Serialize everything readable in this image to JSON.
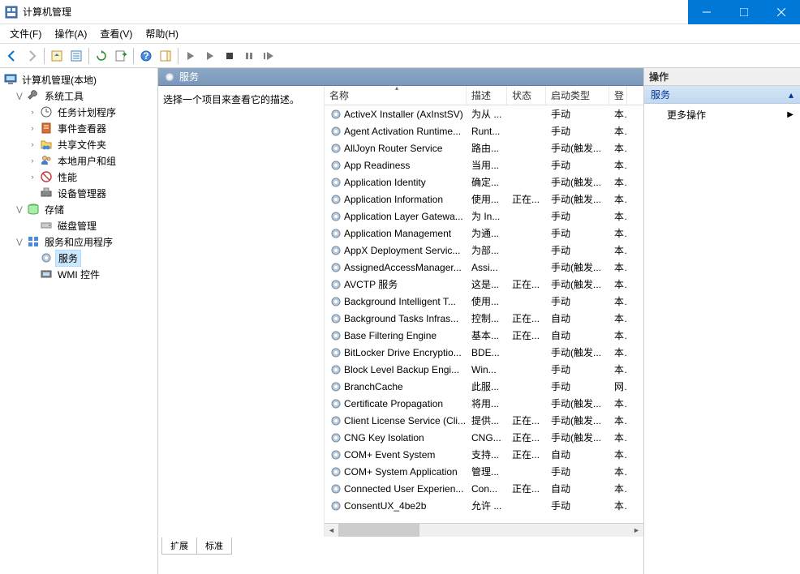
{
  "window": {
    "title": "计算机管理"
  },
  "menu": {
    "file": "文件(F)",
    "action": "操作(A)",
    "view": "查看(V)",
    "help": "帮助(H)"
  },
  "tree": {
    "root": "计算机管理(本地)",
    "system_tools": "系统工具",
    "task_scheduler": "任务计划程序",
    "event_viewer": "事件查看器",
    "shared_folders": "共享文件夹",
    "local_users": "本地用户和组",
    "performance": "性能",
    "device_manager": "设备管理器",
    "storage": "存储",
    "disk_management": "磁盘管理",
    "services_apps": "服务和应用程序",
    "services": "服务",
    "wmi_control": "WMI 控件"
  },
  "mid": {
    "header": "服务",
    "detail_prompt": "选择一个项目来查看它的描述。",
    "cols": {
      "name": "名称",
      "desc": "描述",
      "status": "状态",
      "startup": "启动类型",
      "logon": "登"
    },
    "tabs": {
      "extended": "扩展",
      "standard": "标准"
    }
  },
  "action": {
    "header": "操作",
    "section": "服务",
    "more": "更多操作"
  },
  "services": [
    {
      "name": "ActiveX Installer (AxInstSV)",
      "desc": "为从 ...",
      "status": "",
      "startup": "手动",
      "logon": "本"
    },
    {
      "name": "Agent Activation Runtime...",
      "desc": "Runt...",
      "status": "",
      "startup": "手动",
      "logon": "本"
    },
    {
      "name": "AllJoyn Router Service",
      "desc": "路由...",
      "status": "",
      "startup": "手动(触发...",
      "logon": "本"
    },
    {
      "name": "App Readiness",
      "desc": "当用...",
      "status": "",
      "startup": "手动",
      "logon": "本"
    },
    {
      "name": "Application Identity",
      "desc": "确定...",
      "status": "",
      "startup": "手动(触发...",
      "logon": "本"
    },
    {
      "name": "Application Information",
      "desc": "使用...",
      "status": "正在...",
      "startup": "手动(触发...",
      "logon": "本"
    },
    {
      "name": "Application Layer Gatewa...",
      "desc": "为 In...",
      "status": "",
      "startup": "手动",
      "logon": "本"
    },
    {
      "name": "Application Management",
      "desc": "为通...",
      "status": "",
      "startup": "手动",
      "logon": "本"
    },
    {
      "name": "AppX Deployment Servic...",
      "desc": "为部...",
      "status": "",
      "startup": "手动",
      "logon": "本"
    },
    {
      "name": "AssignedAccessManager...",
      "desc": "Assi...",
      "status": "",
      "startup": "手动(触发...",
      "logon": "本"
    },
    {
      "name": "AVCTP 服务",
      "desc": "这是...",
      "status": "正在...",
      "startup": "手动(触发...",
      "logon": "本"
    },
    {
      "name": "Background Intelligent T...",
      "desc": "使用...",
      "status": "",
      "startup": "手动",
      "logon": "本"
    },
    {
      "name": "Background Tasks Infras...",
      "desc": "控制...",
      "status": "正在...",
      "startup": "自动",
      "logon": "本"
    },
    {
      "name": "Base Filtering Engine",
      "desc": "基本...",
      "status": "正在...",
      "startup": "自动",
      "logon": "本"
    },
    {
      "name": "BitLocker Drive Encryptio...",
      "desc": "BDE...",
      "status": "",
      "startup": "手动(触发...",
      "logon": "本"
    },
    {
      "name": "Block Level Backup Engi...",
      "desc": "Win...",
      "status": "",
      "startup": "手动",
      "logon": "本"
    },
    {
      "name": "BranchCache",
      "desc": "此服...",
      "status": "",
      "startup": "手动",
      "logon": "网"
    },
    {
      "name": "Certificate Propagation",
      "desc": "将用...",
      "status": "",
      "startup": "手动(触发...",
      "logon": "本"
    },
    {
      "name": "Client License Service (Cli...",
      "desc": "提供...",
      "status": "正在...",
      "startup": "手动(触发...",
      "logon": "本"
    },
    {
      "name": "CNG Key Isolation",
      "desc": "CNG...",
      "status": "正在...",
      "startup": "手动(触发...",
      "logon": "本"
    },
    {
      "name": "COM+ Event System",
      "desc": "支持...",
      "status": "正在...",
      "startup": "自动",
      "logon": "本"
    },
    {
      "name": "COM+ System Application",
      "desc": "管理...",
      "status": "",
      "startup": "手动",
      "logon": "本"
    },
    {
      "name": "Connected User Experien...",
      "desc": "Con...",
      "status": "正在...",
      "startup": "自动",
      "logon": "本"
    },
    {
      "name": "ConsentUX_4be2b",
      "desc": "允许 ...",
      "status": "",
      "startup": "手动",
      "logon": "本"
    }
  ]
}
